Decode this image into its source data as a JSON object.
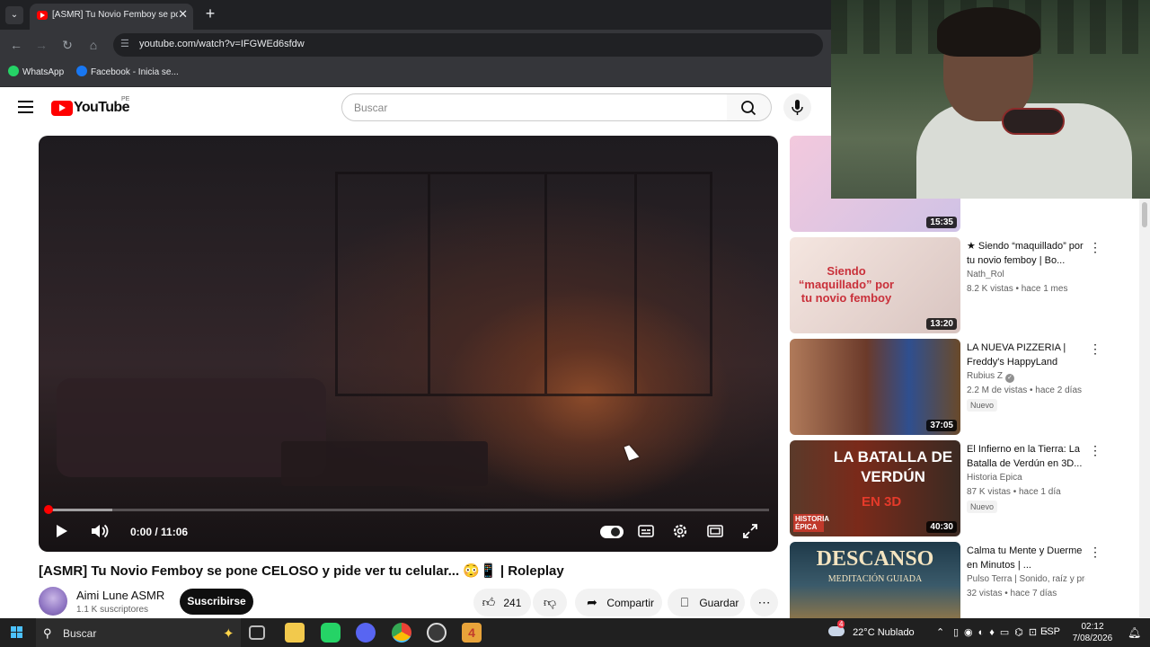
{
  "browser": {
    "tab_title": "[ASMR] Tu Novio Femboy se pc",
    "tab_close": "✕",
    "new_tab": "+",
    "url": "youtube.com/watch?v=IFGWEd6sfdw",
    "bookmarks": [
      {
        "label": "WhatsApp",
        "color": "#25d366"
      },
      {
        "label": "Facebook - Inicia se...",
        "color": "#1877f2"
      }
    ]
  },
  "youtube": {
    "country_code": "PE",
    "logo_text": "YouTube",
    "search_placeholder": "Buscar"
  },
  "player": {
    "time": "0:00 / 11:06",
    "played_fraction": 0.0,
    "buffered_fraction": 0.09
  },
  "video": {
    "title": "[ASMR] Tu Novio Femboy se pone CELOSO y pide ver tu celular... 😳📱 | Roleplay",
    "channel_name": "Aimi Lune ASMR",
    "subscribers": "1.1 K suscriptores",
    "subscribe_label": "Suscribirse",
    "likes": "241",
    "share_label": "Compartir",
    "save_label": "Guardar"
  },
  "recommendations": [
    {
      "title": "",
      "channel": "",
      "meta": "",
      "duration": "15:35",
      "badge": "",
      "colors": [
        "#f3c9dd",
        "#cfc2e6"
      ]
    },
    {
      "title": "★ Siendo “maquillado” por tu novio femboy | Bo...",
      "channel": "Nath_Rol",
      "meta": "8.2 K vistas • hace 1 mes",
      "duration": "13:20",
      "badge": "",
      "colors": [
        "#f5e6e0",
        "#d8c4c0"
      ],
      "overlay": "Siendo “maquillado” por tu novio femboy"
    },
    {
      "title": "LA NUEVA PIZZERIA | Freddy's HappyLand",
      "channel": "Rubius Z",
      "verified": true,
      "meta": "2.2 M de vistas • hace 2 días",
      "duration": "37:05",
      "badge": "Nuevo",
      "colors": [
        "#6b3a2a",
        "#2f4f8f"
      ]
    },
    {
      "title": "El Infierno en la Tierra: La Batalla de Verdún en 3D...",
      "channel": "Historia Épica",
      "meta": "87 K vistas • hace 1 día",
      "duration": "40:30",
      "badge": "Nuevo",
      "colors": [
        "#7a2a1a",
        "#3a2a22"
      ],
      "overlay": "LA BATALLA DE VERDÚN",
      "overlay2": "EN 3D",
      "overlay3": "HISTORIA ÉPICA"
    },
    {
      "title": "Calma tu Mente y Duerme en Minutos | ...",
      "channel": "Pulso Terra | Sonido, raíz y prese...",
      "meta": "32 vistas • hace 7 días",
      "duration": "",
      "badge": "",
      "colors": [
        "#1f3a4a",
        "#b8843a"
      ],
      "overlay": "DESCANSO",
      "overlay2": "MEDITACIÓN GUIADA"
    }
  ],
  "taskbar": {
    "search_label": "Buscar",
    "weather": "22°C  Nublado",
    "weather_badge": "4",
    "language": "ESP",
    "time": "02:12",
    "date": "7/08/2026",
    "apps": [
      {
        "name": "task-view",
        "color": "#3a3a3a"
      },
      {
        "name": "file-explorer",
        "color": "#f2c94c"
      },
      {
        "name": "whatsapp",
        "color": "#25d366"
      },
      {
        "name": "discord",
        "color": "#5865f2"
      },
      {
        "name": "chrome",
        "color": "#34a853"
      },
      {
        "name": "obs",
        "color": "#3a3a3a"
      },
      {
        "name": "app-4",
        "color": "#e8a33a"
      }
    ]
  },
  "colors": {
    "brand_red": "#ff0000",
    "chrome_dark": "#202124",
    "chrome_toolbar": "#35363a"
  }
}
